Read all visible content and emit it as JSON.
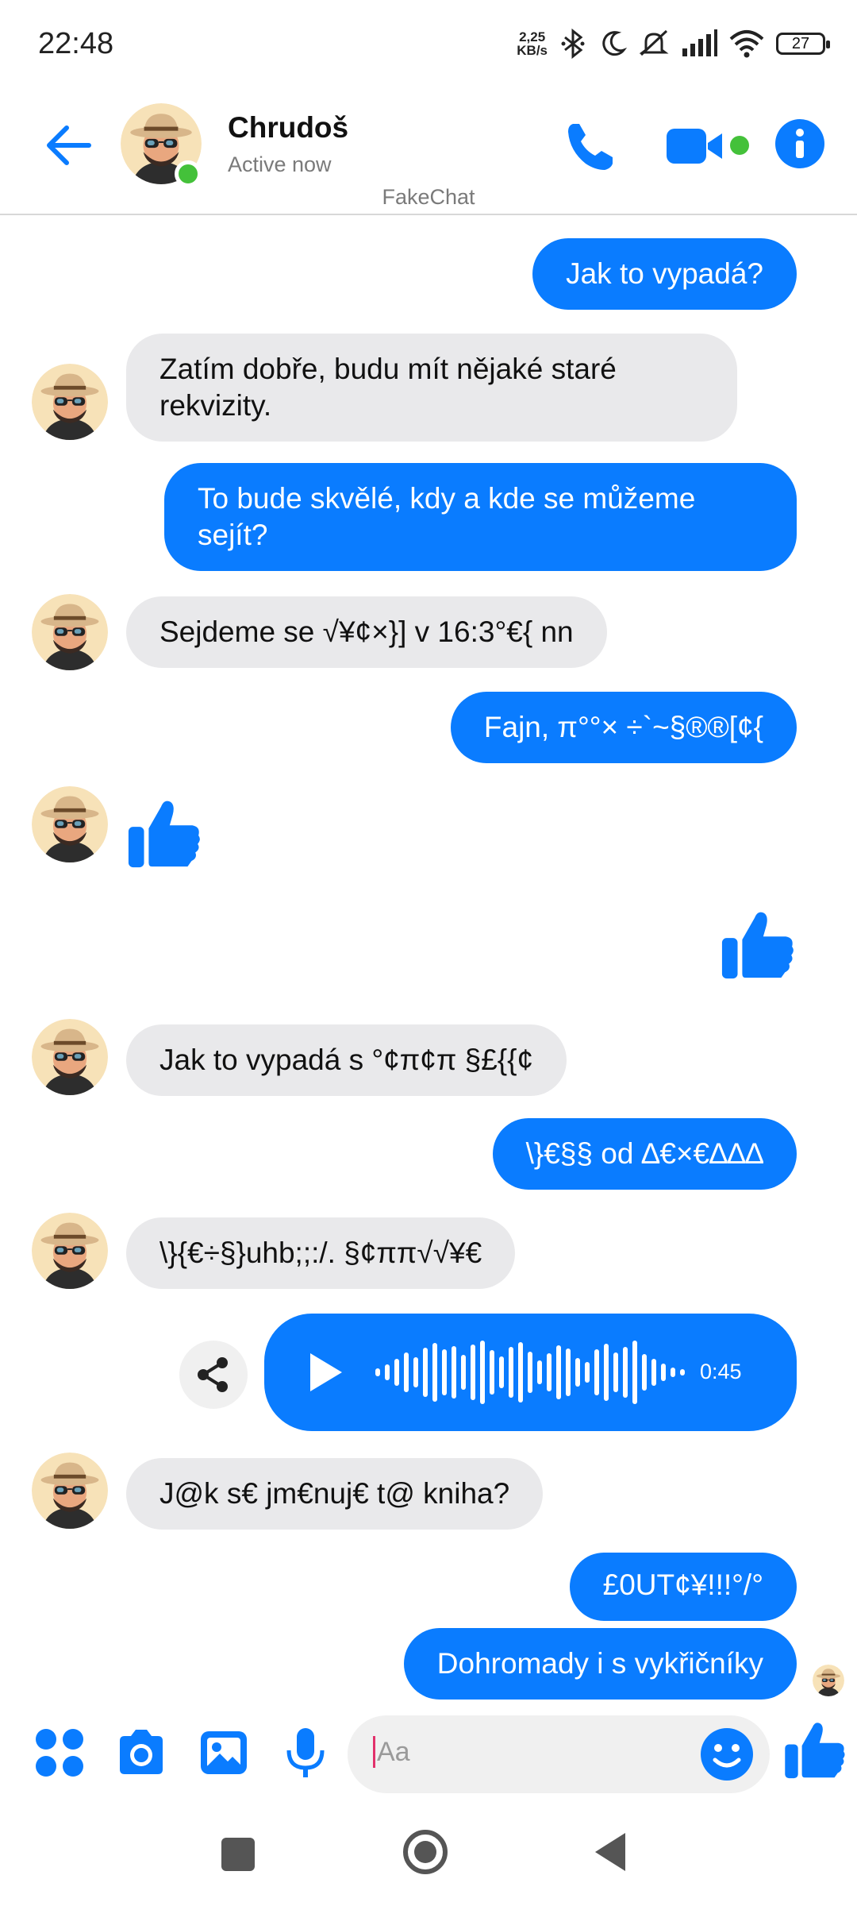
{
  "status_bar": {
    "time": "22:48",
    "net_speed_value": "2,25",
    "net_speed_unit": "KB/s",
    "battery": "27",
    "icons": [
      "bluetooth-icon",
      "moon-icon",
      "mute-icon",
      "signal-icon",
      "wifi-icon",
      "battery-icon"
    ]
  },
  "header": {
    "contact_name": "Chrudoš",
    "status": "Active now",
    "app_label": "FakeChat",
    "icons": [
      "back-arrow-icon",
      "phone-icon",
      "video-icon",
      "info-icon"
    ]
  },
  "messages": [
    {
      "from": "me",
      "text": "Jak to vypadá?"
    },
    {
      "from": "contact",
      "text": "Zatím dobře, budu mít nějaké staré rekvizity."
    },
    {
      "from": "me",
      "text": "To bude skvělé, kdy a kde se můžeme sejít?"
    },
    {
      "from": "contact",
      "text": "Sejdeme se √¥¢×}] v 16:3°€{ nn"
    },
    {
      "from": "me",
      "text": "Fajn, π°°× ÷`~§®®[¢{"
    },
    {
      "from": "contact",
      "type": "like"
    },
    {
      "from": "me",
      "type": "like"
    },
    {
      "from": "contact",
      "text": "Jak to vypadá s °¢π¢π §£{{¢"
    },
    {
      "from": "me",
      "text": "\\}€§§ od ∆€×€∆∆∆"
    },
    {
      "from": "contact",
      "text": "\\}{€÷§}uhb;;:/. §¢ππ√√¥€"
    },
    {
      "from": "me",
      "type": "voice",
      "duration": "0:45"
    },
    {
      "from": "contact",
      "text": "J@k s€ jm€nuj€ t@ kniha?"
    },
    {
      "from": "me",
      "text": "£0UT¢¥!!!°/°"
    },
    {
      "from": "me",
      "text": "Dohromady i s vykřičníky"
    }
  ],
  "composer": {
    "placeholder": "Aa",
    "icons": [
      "apps-icon",
      "camera-icon",
      "gallery-icon",
      "mic-icon",
      "emoji-icon",
      "thumbs-up-icon"
    ]
  },
  "colors": {
    "accent": "#0a7cff",
    "incoming_bubble": "#e9e9eb",
    "online": "#44c13a"
  }
}
